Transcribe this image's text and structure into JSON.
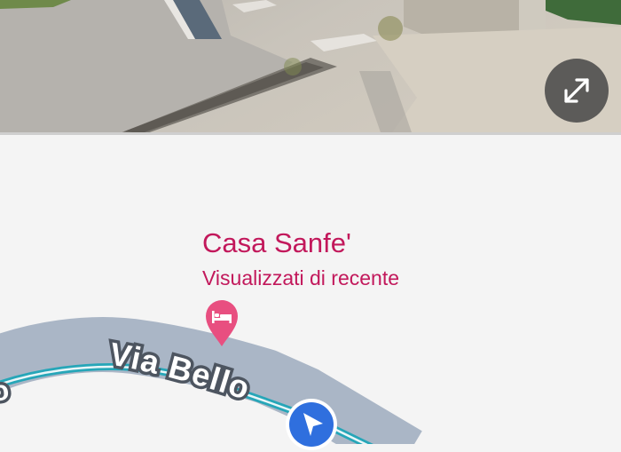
{
  "street_view": {
    "expand_icon": "expand-arrows-icon"
  },
  "map": {
    "place": {
      "name": "Casa Sanfe'",
      "subtitle": "Visualizzati di recente",
      "pin_icon": "hotel-bed-icon",
      "color": "#c2185b"
    },
    "road_label": "Via Bello",
    "road_label_left_fragment": "o",
    "route_color": "#26a6b8",
    "road_color": "#aab6c6",
    "location_icon": "navigation-arrow-icon",
    "location_color": "#2f6fde"
  }
}
